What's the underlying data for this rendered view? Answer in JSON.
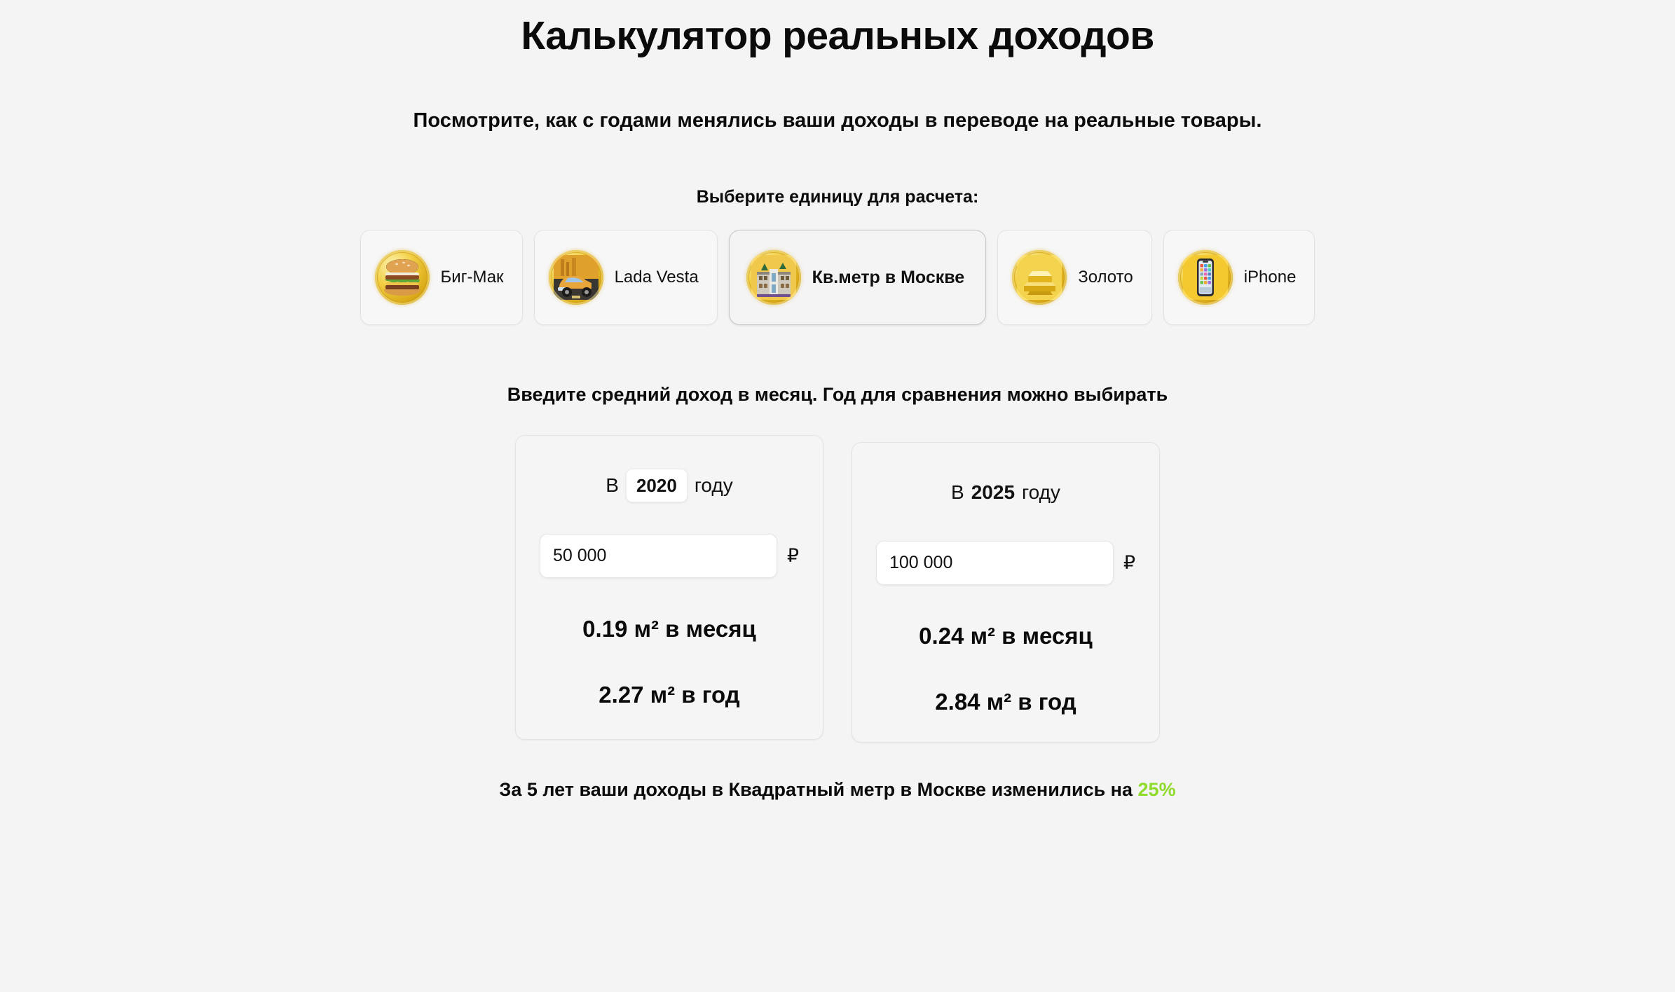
{
  "header": {
    "title": "Калькулятор реальных доходов",
    "subtitle": "Посмотрите, как с годами менялись ваши доходы в переводе на реальные товары."
  },
  "unit_picker": {
    "label": "Выберите единицу для расчета:",
    "selected_id": "sqm-moscow",
    "options": [
      {
        "id": "big-mac",
        "label": "Биг-Мак",
        "icon": "burger-coin-icon",
        "selected": false
      },
      {
        "id": "lada-vesta",
        "label": "Lada Vesta",
        "icon": "car-coin-icon",
        "selected": false
      },
      {
        "id": "sqm-moscow",
        "label": "Кв.метр в Москве",
        "icon": "building-coin-icon",
        "selected": true
      },
      {
        "id": "gold",
        "label": "Золото",
        "icon": "gold-bar-coin-icon",
        "selected": false
      },
      {
        "id": "iphone",
        "label": "iPhone",
        "icon": "smartphone-coin-icon",
        "selected": false
      }
    ]
  },
  "input_section": {
    "instruction": "Введите средний доход в месяц. Год для сравнения можно выбирать",
    "cards": [
      {
        "year_prefix": "В",
        "year_value": "2020",
        "year_suffix": "году",
        "year_editable": true,
        "amount_value": "50 000",
        "amount_placeholder": "50 000",
        "currency_symbol": "₽",
        "result_month": "0.19 м² в месяц",
        "result_year": "2.27 м² в год"
      },
      {
        "year_prefix": "В",
        "year_value": "2025",
        "year_suffix": "году",
        "year_editable": false,
        "amount_value": "100 000",
        "amount_placeholder": "100 000",
        "currency_symbol": "₽",
        "result_month": "0.24 м² в месяц",
        "result_year": "2.84 м² в год"
      }
    ]
  },
  "summary": {
    "text_before": "За 5 лет ваши доходы в Квадратный метр в Москве изменились на",
    "percent": "25%",
    "percent_color": "#8fdb2b"
  },
  "theme": {
    "page_background": "#f4f4f5",
    "card_background": "#f5f5f6",
    "card_border": "#e3e3e5",
    "selected_chip_border": "#c7c7cb",
    "text_color": "#0b0b0c",
    "coin_gold": "#d8a715"
  }
}
